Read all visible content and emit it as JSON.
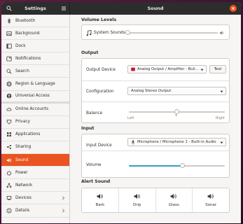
{
  "window": {
    "sidebar_title": "Settings",
    "panel_title": "Sound"
  },
  "icons": {
    "search": "search-icon",
    "menu": "hamburger-menu-icon",
    "close": "close-icon"
  },
  "colors": {
    "accent": "#e95420",
    "slider_fill": "#30a0c6",
    "titlebar": "#2d2d2d"
  },
  "sidebar": {
    "items": [
      {
        "label": "Bluetooth",
        "icon": "bluetooth-icon"
      },
      {
        "label": "Background",
        "icon": "background-icon"
      },
      {
        "label": "Dock",
        "icon": "dock-icon"
      },
      {
        "label": "Notifications",
        "icon": "notifications-icon"
      },
      {
        "label": "Search",
        "icon": "search-icon"
      },
      {
        "label": "Region & Language",
        "icon": "region-icon"
      },
      {
        "label": "Universal Access",
        "icon": "universal-access-icon"
      },
      {
        "label": "Online Accounts",
        "icon": "online-accounts-icon"
      },
      {
        "label": "Privacy",
        "icon": "privacy-icon"
      },
      {
        "label": "Applications",
        "icon": "applications-icon"
      },
      {
        "label": "Sharing",
        "icon": "sharing-icon"
      },
      {
        "label": "Sound",
        "icon": "sound-icon",
        "active": true
      },
      {
        "label": "Power",
        "icon": "power-icon"
      },
      {
        "label": "Network",
        "icon": "network-icon"
      },
      {
        "label": "Devices",
        "icon": "devices-icon",
        "chevron": true
      },
      {
        "label": "Details",
        "icon": "details-icon",
        "chevron": true
      }
    ]
  },
  "volume_levels": {
    "title": "Volume Levels",
    "system_sounds_label": "System Sounds",
    "system_sounds_level": 0
  },
  "output": {
    "title": "Output",
    "device_label": "Output Device",
    "device_value": "Analog Output / Amplifier - Buil...",
    "test_label": "Test",
    "configuration_label": "Configuration",
    "configuration_value": "Analog Stereo Output",
    "balance_label": "Balance",
    "balance_left": "Left",
    "balance_right": "Right",
    "balance_value": 0.5
  },
  "input": {
    "title": "Input",
    "device_label": "Input Device",
    "device_value": "Microphone / Microphone 1 - Built-in Audio",
    "volume_label": "Volume",
    "volume_level": 0.56
  },
  "alert_sound": {
    "title": "Alert Sound",
    "options": [
      {
        "label": "Bark"
      },
      {
        "label": "Drip"
      },
      {
        "label": "Glass"
      },
      {
        "label": "Sonar"
      }
    ]
  }
}
